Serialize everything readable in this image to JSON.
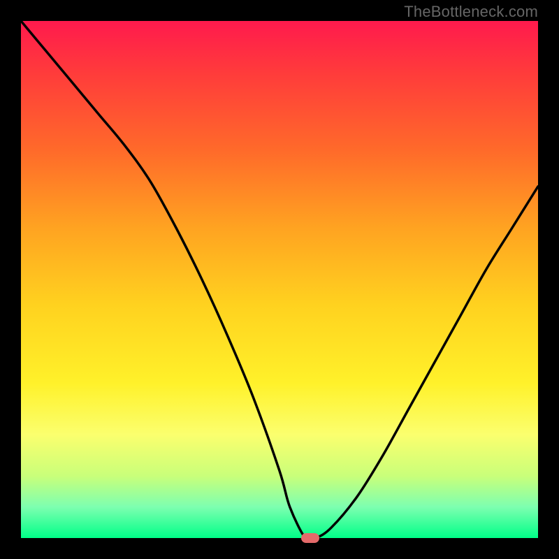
{
  "attribution": "TheBottleneck.com",
  "chart_data": {
    "type": "line",
    "title": "",
    "xlabel": "",
    "ylabel": "",
    "xlim": [
      0,
      100
    ],
    "ylim": [
      0,
      100
    ],
    "series": [
      {
        "name": "bottleneck-curve",
        "x": [
          0,
          5,
          10,
          15,
          20,
          25,
          30,
          35,
          40,
          45,
          50,
          52,
          55,
          57,
          60,
          65,
          70,
          75,
          80,
          85,
          90,
          95,
          100
        ],
        "values": [
          100,
          94,
          88,
          82,
          76,
          69,
          60,
          50,
          39,
          27,
          13,
          6,
          0,
          0,
          2,
          8,
          16,
          25,
          34,
          43,
          52,
          60,
          68
        ]
      }
    ],
    "gradient_bands": [
      {
        "pct": 0,
        "color": "#ff1a4d"
      },
      {
        "pct": 10,
        "color": "#ff3b3b"
      },
      {
        "pct": 25,
        "color": "#ff6a2a"
      },
      {
        "pct": 40,
        "color": "#ffa321"
      },
      {
        "pct": 55,
        "color": "#ffd21f"
      },
      {
        "pct": 70,
        "color": "#fff12a"
      },
      {
        "pct": 80,
        "color": "#fbff6e"
      },
      {
        "pct": 88,
        "color": "#c9ff7a"
      },
      {
        "pct": 94,
        "color": "#7dffb0"
      },
      {
        "pct": 100,
        "color": "#00ff88"
      }
    ],
    "marker": {
      "x": 56,
      "y": 0,
      "color": "#e46a6a"
    }
  }
}
